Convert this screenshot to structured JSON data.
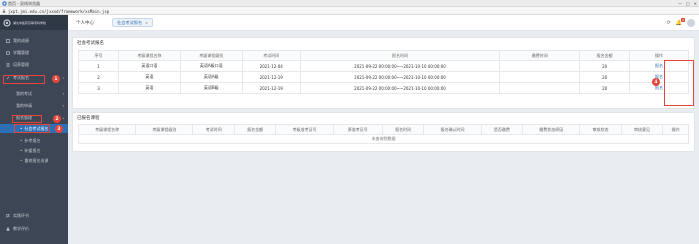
{
  "browser": {
    "title": "首页 - 双线浏览器",
    "url": "jxpt.jmi.edu.cn/jxxxd/framework/xsMain.jsp",
    "window_controls": [
      "—",
      "□",
      "✕"
    ]
  },
  "sidebar": {
    "school_name": "湖北中医药高等专科学校",
    "items": [
      {
        "label": "我的成绩",
        "icon": "grade-icon"
      },
      {
        "label": "学籍管理",
        "icon": "id-card-icon"
      },
      {
        "label": "培养管理",
        "icon": "list-icon"
      },
      {
        "label": "考试报名",
        "icon": "edit-icon"
      }
    ],
    "sub_items": [
      {
        "label": "我的考试"
      },
      {
        "label": "我的申请"
      },
      {
        "label": "报名管理"
      }
    ],
    "leaf_items": [
      {
        "label": "社会考试报名"
      },
      {
        "label": "补考报名"
      },
      {
        "label": "补缓报名"
      },
      {
        "label": "重修报名选课"
      }
    ],
    "bottom_items": [
      {
        "label": "实践环节",
        "icon": "flag-icon"
      },
      {
        "label": "教学评价",
        "icon": "person-icon"
      }
    ],
    "annotations": [
      "1",
      "2",
      "3"
    ]
  },
  "top": {
    "crumb": "个人中心",
    "tab": "社会考试报名",
    "tab_close": "×",
    "bell_count": "0"
  },
  "exam_panel": {
    "title": "社会考试报名",
    "headers": [
      "序号",
      "考级课程名称",
      "考级课程级别",
      "考试时间",
      "报名时间",
      "缴费时间",
      "报名金额",
      "操作"
    ],
    "rows": [
      [
        "1",
        "英语口语",
        "英语A级口语",
        "2021-12-04",
        "2021-09-22 00:00:00~~2021-10-10 00:00:00",
        "",
        "20",
        "报名"
      ],
      [
        "2",
        "英语",
        "英语A级",
        "2021-12-19",
        "2021-09-22 00:00:00~~2021-10-10 00:00:00",
        "",
        "20",
        "报名"
      ],
      [
        "3",
        "英语",
        "英语B级",
        "2021-12-19",
        "2021-09-22 00:00:00~~2021-10-10 00:00:00",
        "",
        "20",
        "报名"
      ]
    ],
    "annotation": "4"
  },
  "applied_panel": {
    "title": "已报名课程",
    "headers": [
      "考级课程名称",
      "考级课程级别",
      "考试时间",
      "报名金额",
      "考级准考证号",
      "原准考证号",
      "报名时间",
      "报名确认时间",
      "是否缴费",
      "缴费状态原因",
      "审核状态",
      "审核意见",
      "操作"
    ],
    "empty_text": "未查询到数据"
  },
  "colors": {
    "sidebar_bg": "#3d4654",
    "active_blue": "#2d6fb5",
    "annotation_red": "#e5463b"
  }
}
